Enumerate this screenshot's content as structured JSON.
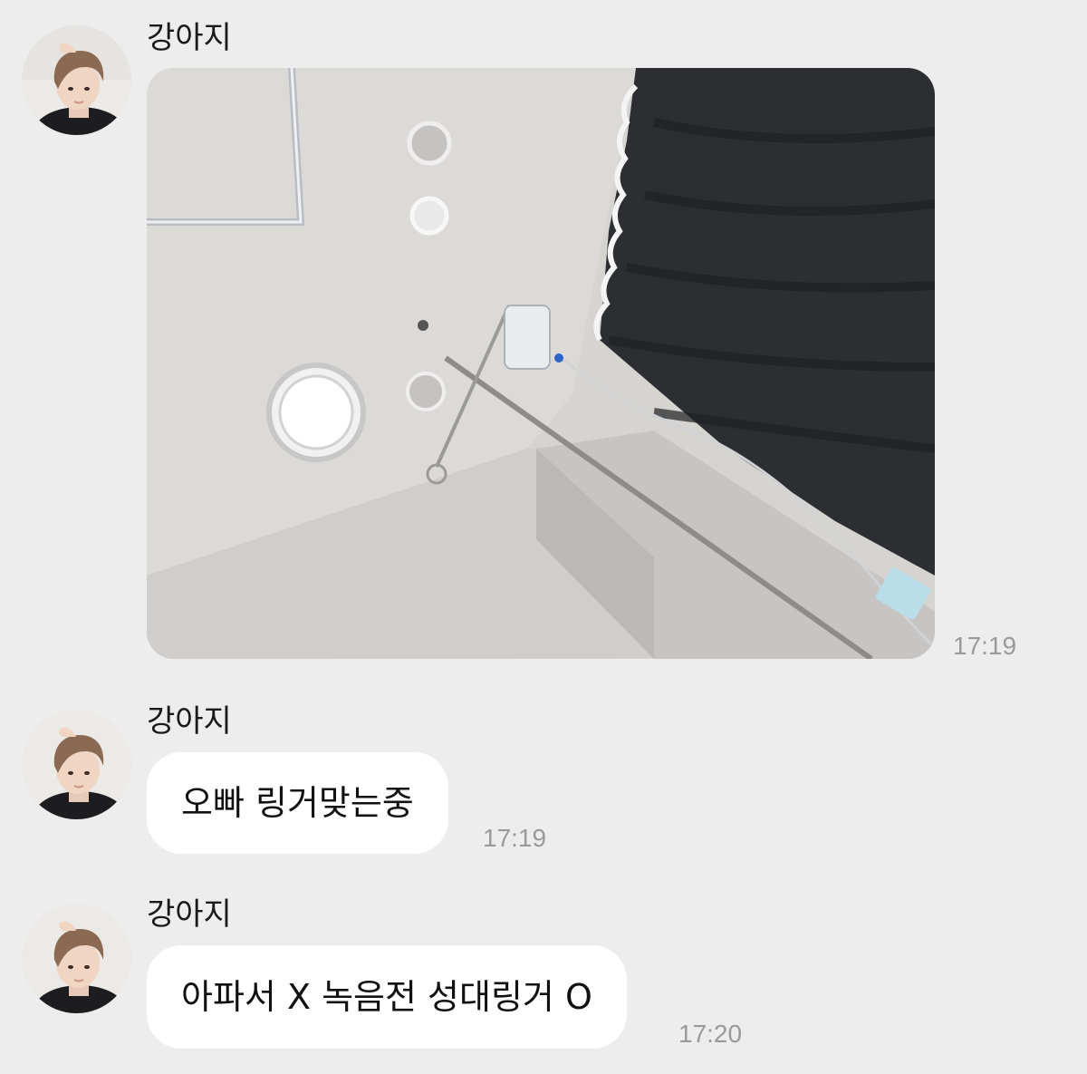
{
  "messages": [
    {
      "sender": "강아지",
      "type": "image",
      "time": "17:19"
    },
    {
      "sender": "강아지",
      "type": "text",
      "text": "오빠 링거맞는중",
      "time": "17:19"
    },
    {
      "sender": "강아지",
      "type": "text",
      "text": "아파서 X 녹음전 성대링거 O",
      "time": "17:20"
    }
  ],
  "icons": {
    "avatar": "profile-photo",
    "photo": "hospital-ceiling-iv-drip-photo"
  },
  "colors": {
    "background": "#ededed",
    "bubble": "#ffffff",
    "timestamp": "#9a9a9a"
  }
}
